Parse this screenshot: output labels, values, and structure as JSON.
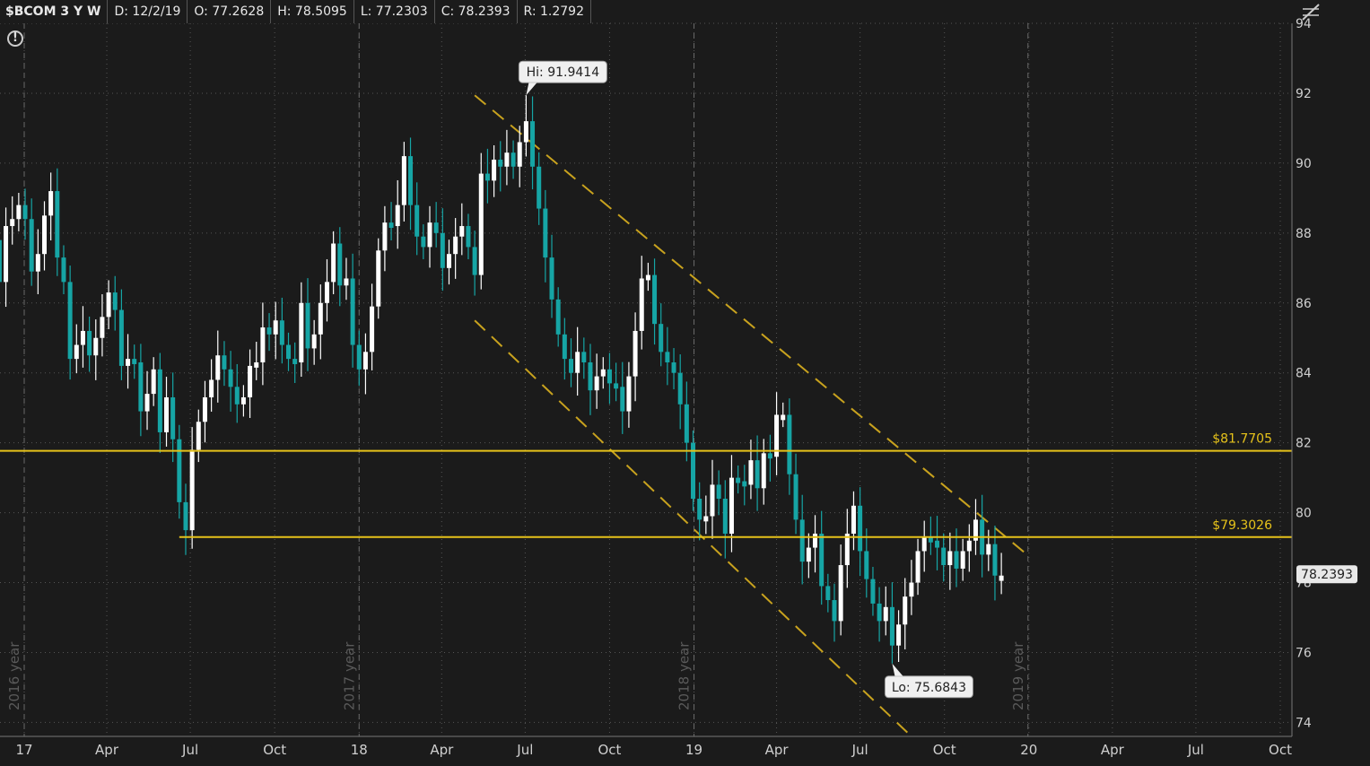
{
  "header": {
    "symbol": "$BCOM 3 Y W",
    "date": "D: 12/2/19",
    "open": "O: 77.2628",
    "high": "H: 78.5095",
    "low": "L: 77.2303",
    "close": "C: 78.2393",
    "range": "R: 1.2792"
  },
  "icons": {
    "alert": "info-alert-icon",
    "drawing": "drawing-style-icon"
  },
  "colors": {
    "background": "#1b1b1b",
    "up_candle": "#ffffff",
    "down_candle": "#16a5a5",
    "level_line": "#e6c21a",
    "channel_line": "#c8a21e",
    "grid": "#555555"
  },
  "chart_data": {
    "type": "candlestick",
    "period": "weekly",
    "x_tick_labels": [
      "17",
      "Apr",
      "Jul",
      "Oct",
      "18",
      "Apr",
      "Jul",
      "Oct",
      "19",
      "Apr",
      "Jul",
      "Oct",
      "20",
      "Apr",
      "Jul",
      "Oct"
    ],
    "year_markers": [
      "2016 year",
      "2017 year",
      "2018 year",
      "2019 year"
    ],
    "y_ticks": [
      74,
      76,
      78,
      80,
      82,
      84,
      86,
      88,
      90,
      92,
      94
    ],
    "ylim": [
      73.6,
      94.0
    ],
    "hi_label": "Hi: 91.9414",
    "lo_label": "Lo: 75.6843",
    "hi_value": 91.9414,
    "lo_value": 75.6843,
    "last_price_label": "78.2393",
    "last_price": 78.2393,
    "levels": [
      {
        "label": "$81.7705",
        "value": 81.7705
      },
      {
        "label": "$79.3026",
        "value": 79.3026
      }
    ],
    "channel_lines": [
      {
        "from": {
          "date": "2018-05-07",
          "value": 91.94
        },
        "to": {
          "date": "2019-12-30",
          "value": 78.8
        }
      },
      {
        "from": {
          "date": "2018-05-07",
          "value": 85.5
        },
        "to": {
          "date": "2019-08-26",
          "value": 73.6
        }
      }
    ],
    "closes": [
      88.7,
      87.2,
      86.9,
      87.8,
      86.6,
      88.2,
      88.4,
      88.8,
      88.4,
      86.9,
      87.4,
      88.5,
      89.2,
      87.3,
      86.6,
      84.4,
      84.8,
      85.2,
      84.5,
      85.0,
      85.6,
      86.3,
      85.8,
      84.2,
      84.4,
      84.3,
      82.9,
      83.4,
      84.1,
      82.3,
      83.3,
      82.1,
      80.3,
      79.5,
      81.8,
      82.6,
      83.3,
      83.8,
      84.5,
      84.1,
      83.6,
      83.1,
      83.3,
      84.2,
      84.3,
      85.3,
      85.1,
      85.5,
      84.8,
      84.4,
      84.3,
      86.0,
      84.7,
      85.1,
      86.0,
      86.6,
      87.7,
      86.5,
      86.7,
      84.8,
      84.1,
      84.6,
      85.9,
      87.5,
      88.3,
      88.2,
      88.8,
      90.2,
      88.8,
      87.9,
      87.6,
      88.3,
      88.0,
      87.0,
      87.4,
      87.9,
      88.2,
      87.6,
      86.8,
      89.7,
      89.5,
      90.1,
      89.9,
      90.3,
      89.9,
      90.6,
      91.2,
      89.9,
      88.7,
      87.3,
      86.1,
      85.1,
      84.4,
      84.0,
      84.6,
      84.3,
      83.5,
      83.9,
      84.1,
      83.7,
      83.6,
      82.9,
      83.9,
      85.2,
      86.7,
      86.8,
      85.4,
      84.6,
      84.3,
      84.0,
      83.1,
      82.0,
      80.4,
      79.8,
      79.9,
      80.8,
      80.4,
      79.4,
      81.0,
      80.9,
      80.8,
      81.5,
      80.7,
      81.7,
      81.6,
      82.8,
      82.8,
      81.1,
      79.8,
      78.6,
      79.0,
      79.4,
      77.9,
      77.5,
      76.9,
      78.5,
      79.4,
      80.2,
      78.9,
      78.1,
      77.4,
      76.9,
      77.3,
      76.2,
      76.8,
      77.6,
      78.0,
      78.9,
      79.3,
      79.2,
      79.0,
      78.5,
      78.9,
      78.4,
      78.9,
      79.2,
      79.8,
      78.8,
      79.1,
      78.2,
      78.2
    ]
  }
}
